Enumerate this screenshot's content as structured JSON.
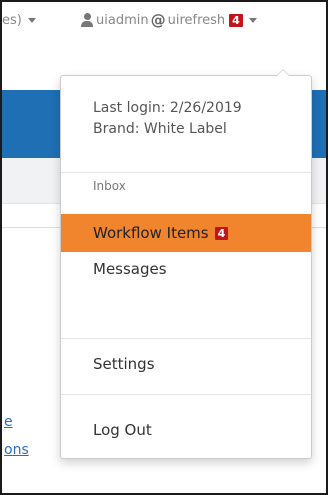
{
  "header": {
    "left_dropdown_label": "es)",
    "user_name": "uiadmin",
    "at_symbol": "@",
    "site_name": "uirefresh",
    "notification_count": "4"
  },
  "dropdown": {
    "last_login": "Last login: 2/26/2019",
    "brand": "Brand: White Label",
    "inbox_header": "Inbox",
    "items": [
      {
        "label": "Workflow Items",
        "badge": "4",
        "active": true
      },
      {
        "label": "Messages"
      },
      {
        "label": "Settings"
      },
      {
        "label": "Log Out"
      }
    ]
  },
  "page": {
    "link_1": "e",
    "link_2": "ons"
  },
  "colors": {
    "accent_orange": "#f0852d",
    "header_blue": "#1f6fb5",
    "badge_red": "#c0161a"
  },
  "icons": [
    "user-icon",
    "caret-down-icon"
  ]
}
